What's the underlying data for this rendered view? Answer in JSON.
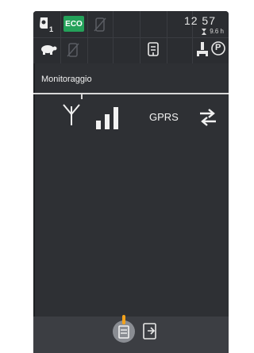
{
  "status_bar": {
    "gear_number": "1",
    "eco_label": "ECO",
    "time": "12 57",
    "hour_meter": "9.6 h",
    "parking_label": "P"
  },
  "main": {
    "title": "Monitoraggio",
    "network_type": "GPRS"
  },
  "colors": {
    "eco_green": "#24a25a",
    "active_indicator": "#f3a21b",
    "screen_bg": "#2e3034"
  },
  "icons": {
    "status_row1": [
      "tractor-gear-icon",
      "eco-badge",
      "phone-disabled-icon"
    ],
    "status_row2": [
      "turtle-speed-icon",
      "phone-disabled-icon",
      "hitch-icon",
      "pto-icon",
      "parking-icon"
    ],
    "main": [
      "antenna-icon",
      "signal-strength-icon",
      "data-transfer-icon"
    ],
    "bottom": [
      "monitor-tab-icon",
      "exit-tab-icon"
    ]
  }
}
